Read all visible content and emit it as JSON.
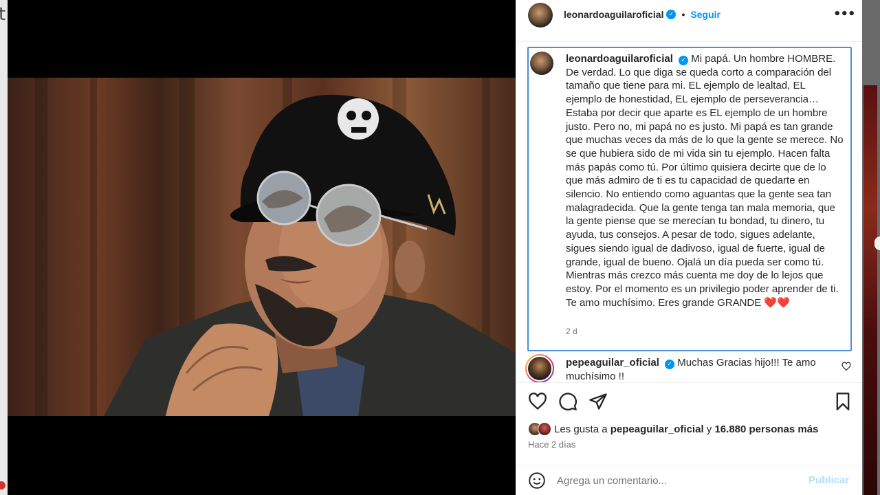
{
  "backdrop": {
    "left_letter": "t"
  },
  "header": {
    "username": "leonardoaguilaroficial",
    "separator": "•",
    "follow_label": "Seguir",
    "more_icon": "more-horizontal-icon"
  },
  "caption": {
    "username": "leonardoaguilaroficial",
    "text": "Mi papá. Un hombre HOMBRE. De verdad. Lo que diga se queda corto a comparación del tamaño que tiene para mi. EL ejemplo de lealtad, EL ejemplo de honestidad, EL ejemplo de perseverancia… Estaba por decir que aparte es EL ejemplo de un hombre justo. Pero no, mi papá no es justo. Mi papá es tan grande que muchas veces da más de lo que la gente se merece. No se que hubiera sido de mi vida sin tu ejemplo. Hacen falta más papás como tú. Por último quisiera decirte que de lo que más admiro de ti es tu capacidad de quedarte en silencio. No entiendo como aguantas que la gente sea tan malagradecida. Que la gente tenga tan mala memoria, que la gente piense que se merecían tu bondad, tu dinero, tu ayuda, tus consejos. A pesar de todo, sigues adelante, sigues siendo igual de dadivoso, igual de fuerte, igual de grande, igual de bueno. Ojalá un día pueda ser como tú. Mientras más crezco más cuenta me doy de lo lejos que estoy. Por el momento es un privilegio poder aprender de ti. Te amo muchísimo. Eres grande GRANDE ❤️❤️",
    "time": "2 d"
  },
  "comment": {
    "username": "pepeaguilar_oficial",
    "text": "Muchas Gracias hijo!!! Te amo muchísimo !!"
  },
  "likes": {
    "prefix": "Les gusta a",
    "user": "pepeaguilar_oficial",
    "connector": "y",
    "others": "16.880 personas más"
  },
  "time_ago": "Hace 2 días",
  "add_comment": {
    "placeholder": "Agrega un comentario...",
    "publish_label": "Publicar"
  },
  "colors": {
    "accent": "#0095f6",
    "focus_border": "#4a8fd8",
    "text": "#262626",
    "muted": "#737373"
  }
}
